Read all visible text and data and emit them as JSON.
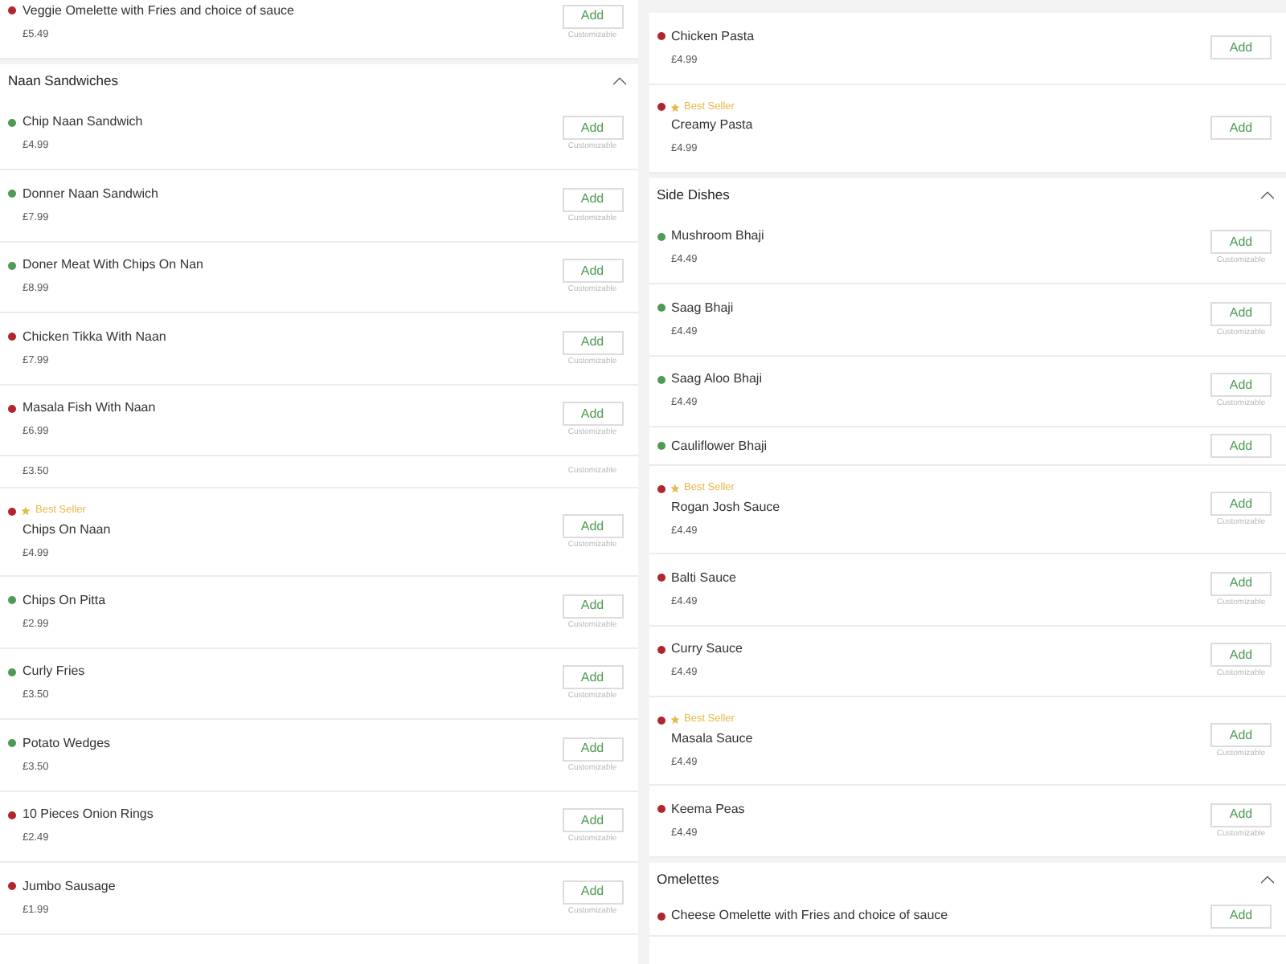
{
  "columns": [
    {
      "rows": [
        {
          "kind": "item",
          "name": "Veggie Omelette with Fries and choice of sauce",
          "price": "£5.49",
          "color": "#b0262c",
          "best_seller": false,
          "button": "Add",
          "note": "Customizable"
        },
        {
          "kind": "section",
          "title": "Naan Sandwiches",
          "expanded": true
        },
        {
          "kind": "item",
          "name": "Chip Naan Sandwich",
          "price": "£4.99",
          "color": "#4f9a55",
          "best_seller": false,
          "button": "Add",
          "note": "Customizable"
        },
        {
          "kind": "item",
          "name": "Donner Naan Sandwich",
          "price": "£7.99",
          "color": "#4f9a55",
          "best_seller": false,
          "button": "Add",
          "note": "Customizable"
        },
        {
          "kind": "item",
          "name": "Doner Meat With Chips On Nan",
          "price": "£8.99",
          "color": "#4f9a55",
          "best_seller": false,
          "button": "Add",
          "note": "Customizable"
        },
        {
          "kind": "item",
          "name": "Chicken Tikka With Naan",
          "price": "£7.99",
          "color": "#b0262c",
          "best_seller": false,
          "button": "Add",
          "note": "Customizable"
        },
        {
          "kind": "item",
          "name": "Masala Fish With Naan",
          "price": "£6.99",
          "color": "#b0262c",
          "best_seller": false,
          "button": "Add",
          "note": "Customizable"
        },
        {
          "kind": "price_only",
          "price": "£3.50",
          "note": "Customizable"
        },
        {
          "kind": "item",
          "name": "Chips On Naan",
          "price": "£4.99",
          "color": "#b0262c",
          "best_seller": true,
          "badge": "Best Seller",
          "button": "Add",
          "note": "Customizable"
        },
        {
          "kind": "item",
          "name": "Chips On Pitta",
          "price": "£2.99",
          "color": "#4f9a55",
          "best_seller": false,
          "button": "Add",
          "note": "Customizable"
        },
        {
          "kind": "item",
          "name": "Curly Fries",
          "price": "£3.50",
          "color": "#4f9a55",
          "best_seller": false,
          "button": "Add",
          "note": "Customizable"
        },
        {
          "kind": "item",
          "name": "Potato Wedges",
          "price": "£3.50",
          "color": "#4f9a55",
          "best_seller": false,
          "button": "Add",
          "note": "Customizable"
        },
        {
          "kind": "item",
          "name": "10 Pieces Onion Rings",
          "price": "£2.49",
          "color": "#b0262c",
          "best_seller": false,
          "button": "Add",
          "note": "Customizable"
        },
        {
          "kind": "item",
          "name": "Jumbo Sausage",
          "price": "£1.99",
          "color": "#b0262c",
          "best_seller": false,
          "button": "Add",
          "note": "Customizable"
        }
      ]
    },
    {
      "rows": [
        {
          "kind": "item",
          "name": "Chicken Pasta",
          "price": "£4.99",
          "color": "#b0262c",
          "best_seller": false,
          "button": "Add"
        },
        {
          "kind": "item",
          "name": "Creamy Pasta",
          "price": "£4.99",
          "color": "#b0262c",
          "best_seller": true,
          "badge": "Best Seller",
          "button": "Add"
        },
        {
          "kind": "section",
          "title": "Side Dishes",
          "expanded": true
        },
        {
          "kind": "item",
          "name": "Mushroom Bhaji",
          "price": "£4.49",
          "color": "#4f9a55",
          "best_seller": false,
          "button": "Add",
          "note": "Customizable"
        },
        {
          "kind": "item",
          "name": "Saag Bhaji",
          "price": "£4.49",
          "color": "#4f9a55",
          "best_seller": false,
          "button": "Add",
          "note": "Customizable"
        },
        {
          "kind": "item",
          "name": "Saag Aloo Bhaji",
          "price": "£4.49",
          "color": "#4f9a55",
          "best_seller": false,
          "button": "Add",
          "note": "Customizable"
        },
        {
          "kind": "name_only",
          "name": "Cauliflower Bhaji",
          "color": "#4f9a55",
          "button": "Add"
        },
        {
          "kind": "item",
          "name": "Rogan Josh Sauce",
          "price": "£4.49",
          "color": "#b0262c",
          "best_seller": true,
          "badge": "Best Seller",
          "button": "Add",
          "note": "Customizable"
        },
        {
          "kind": "item",
          "name": "Balti Sauce",
          "price": "£4.49",
          "color": "#b0262c",
          "best_seller": false,
          "button": "Add",
          "note": "Customizable"
        },
        {
          "kind": "item",
          "name": "Curry Sauce",
          "price": "£4.49",
          "color": "#b0262c",
          "best_seller": false,
          "button": "Add",
          "note": "Customizable"
        },
        {
          "kind": "item",
          "name": "Masala Sauce",
          "price": "£4.49",
          "color": "#b0262c",
          "best_seller": true,
          "badge": "Best Seller",
          "button": "Add",
          "note": "Customizable"
        },
        {
          "kind": "item",
          "name": "Keema Peas",
          "price": "£4.49",
          "color": "#b0262c",
          "best_seller": false,
          "button": "Add",
          "note": "Customizable"
        },
        {
          "kind": "section",
          "title": "Omelettes",
          "expanded": true
        },
        {
          "kind": "name_only",
          "name": "Cheese Omelette with Fries and choice of sauce",
          "color": "#b0262c",
          "button": "Add"
        }
      ]
    }
  ]
}
